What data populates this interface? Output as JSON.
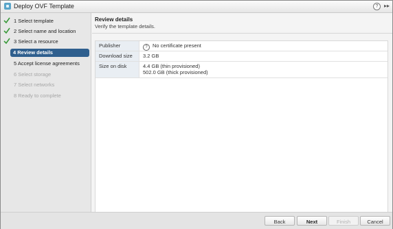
{
  "window": {
    "title": "Deploy OVF Template"
  },
  "icons": {
    "app": "app-icon",
    "help": "help-icon",
    "expand": "expand-icon",
    "check": "check-icon",
    "question": "question-icon"
  },
  "colors": {
    "accent": "#2f5f8e",
    "check": "#3a9a3a"
  },
  "steps": [
    {
      "label": "1  Select template",
      "state": "done"
    },
    {
      "label": "2  Select name and location",
      "state": "done"
    },
    {
      "label": "3  Select a resource",
      "state": "done"
    },
    {
      "label": "4  Review details",
      "state": "active"
    },
    {
      "label": "5  Accept license agreements",
      "state": "current"
    },
    {
      "label": "6  Select storage",
      "state": "disabled"
    },
    {
      "label": "7  Select networks",
      "state": "disabled"
    },
    {
      "label": "8  Ready to complete",
      "state": "disabled"
    }
  ],
  "content": {
    "title": "Review details",
    "subtitle": "Verify the template details."
  },
  "details": {
    "publisher_label": "Publisher",
    "publisher_value": "No certificate present",
    "download_label": "Download size",
    "download_value": "3.2 GB",
    "disk_label": "Size on disk",
    "disk_value_thin": "4.4 GB (thin provisioned)",
    "disk_value_thick": "502.0 GB (thick provisioned)"
  },
  "footer": {
    "back": "Back",
    "next": "Next",
    "finish": "Finish",
    "cancel": "Cancel"
  }
}
